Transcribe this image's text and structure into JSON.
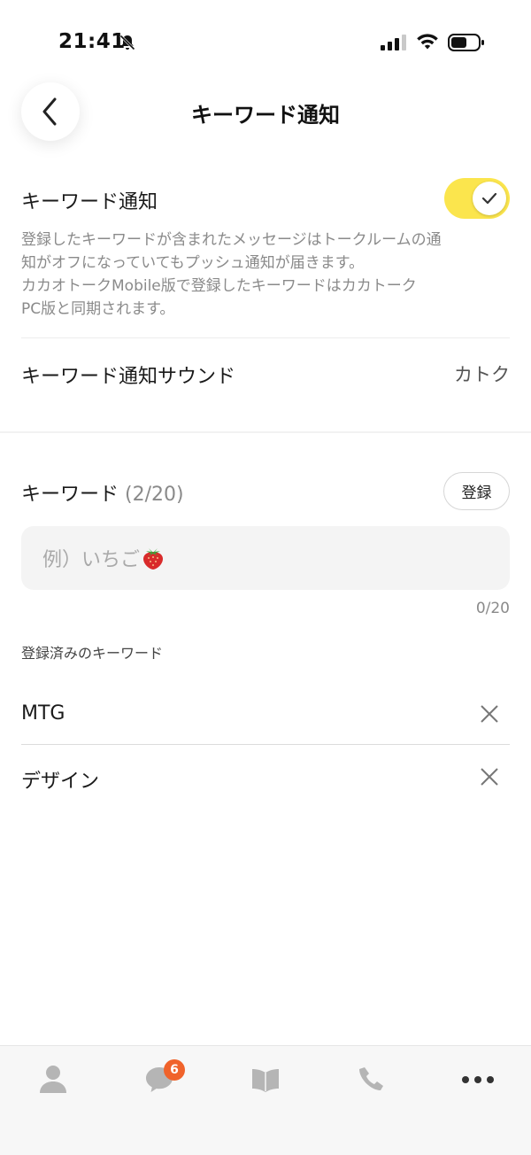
{
  "status_bar": {
    "time": "21:41",
    "icons": [
      "bell-muted-icon",
      "cellular-signal-icon",
      "wifi-icon",
      "battery-icon"
    ]
  },
  "header": {
    "back_icon": "chevron-left-icon",
    "title": "キーワード通知"
  },
  "keyword_notification": {
    "label": "キーワード通知",
    "toggle_on": true,
    "toggle_color": "#fbe54d",
    "description": [
      "登録したキーワードが含まれたメッセージはトークルームの通",
      "知がオフになっていてもプッシュ通知が届きます。",
      "カカオトークMobile版で登録したキーワードはカカトーク",
      "PC版と同期されます。"
    ]
  },
  "sound": {
    "label": "キーワード通知サウンド",
    "value": "カトク"
  },
  "keywords": {
    "title": "キーワード",
    "count": "(2/20)",
    "register_label": "登録",
    "input_placeholder": "例）いちご",
    "input_emoji": "strawberry-icon",
    "char_count": "0/20",
    "registered_label": "登録済みのキーワード",
    "items": [
      {
        "text": "MTG"
      },
      {
        "text": "デザイン"
      }
    ]
  },
  "tab_bar": {
    "tabs": [
      {
        "icon": "person-icon"
      },
      {
        "icon": "chat-bubble-icon",
        "badge": "6"
      },
      {
        "icon": "book-icon"
      },
      {
        "icon": "phone-icon"
      },
      {
        "icon": "more-icon"
      }
    ],
    "badge_color": "#f0632b"
  }
}
